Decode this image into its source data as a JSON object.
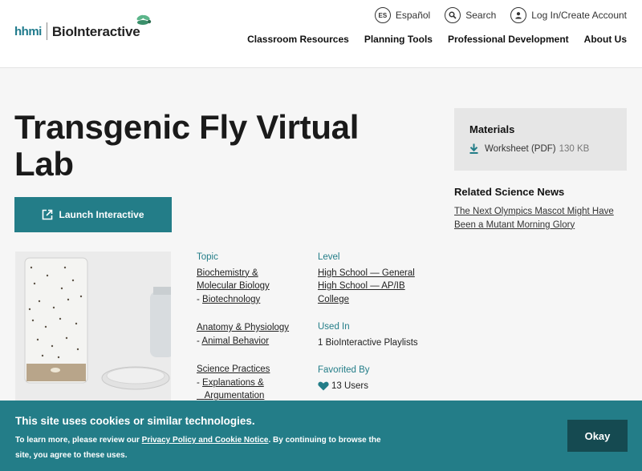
{
  "header": {
    "logo": {
      "hhmi": "hhmi",
      "brand": "BioInteractive"
    },
    "utility": {
      "espanol_badge": "ES",
      "espanol": "Español",
      "search": "Search",
      "login": "Log In/Create Account"
    },
    "nav": [
      "Classroom Resources",
      "Planning Tools",
      "Professional Development",
      "About Us"
    ]
  },
  "page": {
    "title": "Transgenic Fly Virtual Lab",
    "launch_label": "Launch Interactive"
  },
  "topic": {
    "label": "Topic",
    "item1_line1": "Biochemistry &",
    "item1_line2": "Molecular Biology",
    "item1_sub": "Biotechnology",
    "item2": "Anatomy & Physiology",
    "item2_sub": "Animal Behavior",
    "item3": "Science Practices",
    "item3_sub_line1": "Explanations &",
    "item3_sub_line2": "Argumentation",
    "dash": "-"
  },
  "level": {
    "label": "Level",
    "items": [
      "High School — General",
      "High School — AP/IB",
      "College"
    ]
  },
  "used_in": {
    "label": "Used In",
    "value": "1 BioInteractive Playlists"
  },
  "favorited": {
    "label": "Favorited By",
    "value": "13 Users"
  },
  "materials": {
    "heading": "Materials",
    "worksheet": "Worksheet (PDF)",
    "size": "130 KB"
  },
  "news": {
    "heading": "Related Science News",
    "link_line1": "The Next Olympics Mascot Might Have",
    "link_line2": "Been a Mutant Morning Glory"
  },
  "cookie": {
    "heading": "This site uses cookies or similar technologies.",
    "text_pre": "To learn more, please review our ",
    "link": "Privacy Policy and Cookie Notice",
    "text_post": ". By continuing to browse the site, you agree to these uses.",
    "okay": "Okay"
  },
  "colors": {
    "teal": "#237d88",
    "dark_teal": "#154a51"
  },
  "icons": [
    "fly-logo-icon",
    "language-icon",
    "search-icon",
    "user-icon",
    "external-link-icon",
    "download-icon",
    "heart-icon"
  ]
}
